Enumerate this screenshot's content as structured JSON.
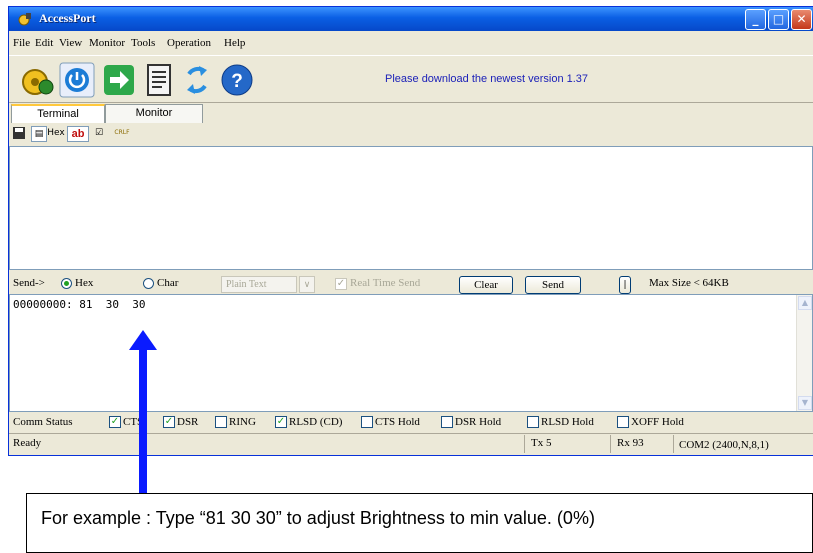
{
  "window": {
    "title": "AccessPort"
  },
  "menu": [
    "File",
    "Edit",
    "View",
    "Monitor",
    "Tools",
    "Operation",
    "Help"
  ],
  "toolbar": {
    "icons": [
      "gear-icon",
      "power-icon",
      "arrow-right-icon",
      "document-icon",
      "refresh-icon",
      "help-icon"
    ],
    "notice": "Please download the newest version 1.37"
  },
  "tabs": [
    {
      "label": "Terminal",
      "active": true
    },
    {
      "label": "Monitor",
      "active": false
    }
  ],
  "subtoolbar": {
    "hex_label": "Hex",
    "ab_label": "ab",
    "crlf_label": "CRLF"
  },
  "send": {
    "prefix": "Send->",
    "hex_label": "Hex",
    "char_label": "Char",
    "hex_selected": true,
    "format_value": "Plain Text",
    "realtime_label": "Real Time Send",
    "clear_label": "Clear",
    "send_label": "Send",
    "pipe_label": "|",
    "max_size": "Max Size < 64KB",
    "content": "00000000: 81  30  30"
  },
  "comm_status": {
    "label": "Comm Status",
    "items": [
      {
        "label": "CTS",
        "checked": true
      },
      {
        "label": "DSR",
        "checked": true
      },
      {
        "label": "RING",
        "checked": false
      },
      {
        "label": "RLSD (CD)",
        "checked": true
      },
      {
        "label": "CTS Hold",
        "checked": false
      },
      {
        "label": "DSR Hold",
        "checked": false
      },
      {
        "label": "RLSD Hold",
        "checked": false
      },
      {
        "label": "XOFF Hold",
        "checked": false
      }
    ]
  },
  "status": {
    "ready": "Ready",
    "tx": "Tx 5",
    "rx": "Rx 93",
    "port": "COM2 (2400,N,8,1)"
  },
  "callout": {
    "text": "For example : Type “81 30 30” to adjust Brightness to min value. (0%)"
  },
  "colors": {
    "arrow": "#0a1bff",
    "notice": "#1d22b8",
    "titlebar": "#0a5fe4"
  }
}
